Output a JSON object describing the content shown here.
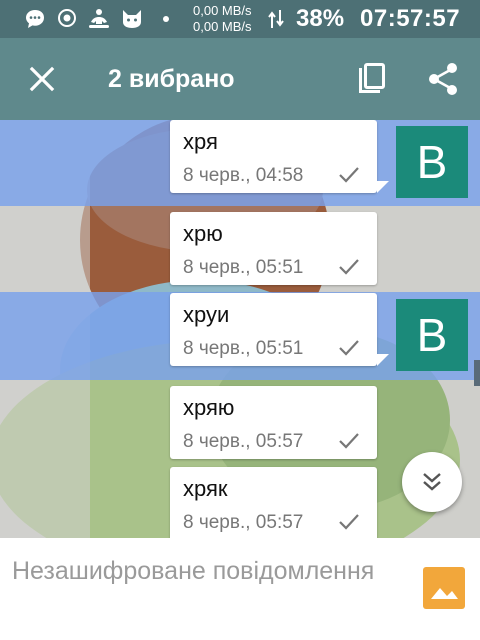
{
  "status_bar": {
    "net_up": "0,00 MB/s",
    "net_down": "0,00 MB/s",
    "battery": "38%",
    "time": "07:57:57",
    "icons": [
      "chat-bubble-icon",
      "record-icon",
      "person-meditate-icon",
      "cat-icon",
      "dot-icon",
      "transfer-arrows-icon"
    ]
  },
  "action_bar": {
    "title": "2 вибрано",
    "icons": [
      "close-icon",
      "copy-icon",
      "share-icon"
    ]
  },
  "messages": [
    {
      "text": "хря",
      "time": "8 черв., 04:58",
      "selected": true,
      "avatar": "B"
    },
    {
      "text": "хрю",
      "time": "8 черв., 05:51",
      "selected": false
    },
    {
      "text": "хруи",
      "time": "8 черв., 05:51",
      "selected": true,
      "avatar": "B"
    },
    {
      "text": "хряю",
      "time": "8 черв., 05:57",
      "selected": false
    },
    {
      "text": "хряк",
      "time": "8 черв., 05:57",
      "selected": false
    }
  ],
  "composer": {
    "placeholder": "Незашифроване повідомлення",
    "attach_icon": "image-icon"
  },
  "colors": {
    "status_bar": "#4d7075",
    "action_bar": "#5f898c",
    "selection": "#79a1ec",
    "avatar": "#1b8a7a",
    "attach": "#f2a73b"
  }
}
